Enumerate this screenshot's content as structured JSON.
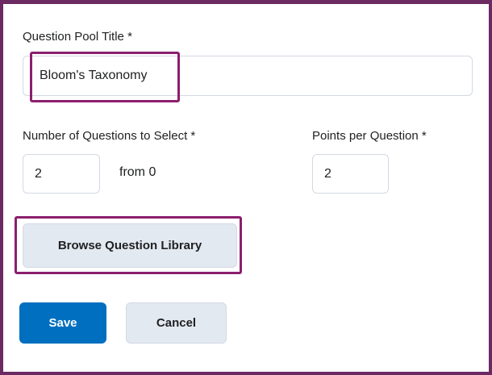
{
  "form": {
    "pool_title": {
      "label": "Question Pool Title *",
      "value": "Bloom's Taxonomy"
    },
    "num_questions": {
      "label": "Number of Questions to Select *",
      "value": "2",
      "from_text": "from 0"
    },
    "points": {
      "label": "Points per Question *",
      "value": "2"
    }
  },
  "actions": {
    "browse_label": "Browse Question Library",
    "save_label": "Save",
    "cancel_label": "Cancel"
  },
  "colors": {
    "frame_border": "#6b2a62",
    "highlight": "#8b1f6e",
    "primary": "#006fbf",
    "secondary_bg": "#e3e9f1"
  }
}
